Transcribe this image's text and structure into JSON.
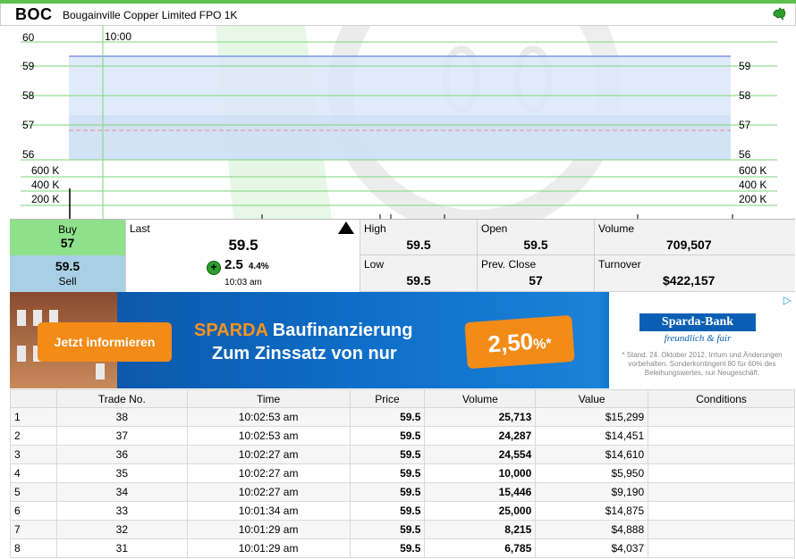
{
  "header": {
    "code": "BOC",
    "name": "Bougainville Copper Limited FPO 1K",
    "flag_icon": "australia-map-icon"
  },
  "chart": {
    "time_label": "10:00",
    "price_ticks": [
      "60",
      "59",
      "58",
      "57",
      "56"
    ],
    "volume_ticks": [
      "600 K",
      "400 K",
      "200 K"
    ],
    "colors": {
      "grid": "#7cd67a",
      "band": "#dbe8f8",
      "line": "#7a9be0"
    }
  },
  "quote": {
    "buy_label": "Buy",
    "buy_value": "57",
    "sell_label": "Sell",
    "sell_value": "59.5",
    "last_label": "Last",
    "last_value": "59.5",
    "change_value": "2.5",
    "change_pct": "4.4%",
    "last_time": "10:03 am",
    "high_label": "High",
    "high_value": "59.5",
    "low_label": "Low",
    "low_value": "59.5",
    "open_label": "Open",
    "open_value": "59.5",
    "prev_close_label": "Prev. Close",
    "prev_close_value": "57",
    "volume_label": "Volume",
    "volume_value": "709,507",
    "turnover_label": "Turnover",
    "turnover_value": "$422,157"
  },
  "ad": {
    "cta": "Jetzt informieren",
    "brand": "SPARDA",
    "headline1": "Baufinanzierung",
    "headline2": "Zum Zinssatz von nur",
    "rate": "2,50",
    "rate_suffix": "%*",
    "bank": "Sparda-Bank",
    "slogan": "freundlich & fair",
    "fineprint": "* Stand: 24. Oktober 2012, Irrtum und Änderungen vorbehalten. Sonderkontingent 80 für 60% des Beleihungswertes, nur Neugeschäft."
  },
  "trades": {
    "headers": [
      "",
      "Trade No.",
      "Time",
      "Price",
      "Volume",
      "Value",
      "Conditions"
    ],
    "rows": [
      [
        "1",
        "38",
        "10:02:53 am",
        "59.5",
        "25,713",
        "$15,299",
        ""
      ],
      [
        "2",
        "37",
        "10:02:53 am",
        "59.5",
        "24,287",
        "$14,451",
        ""
      ],
      [
        "3",
        "36",
        "10:02:27 am",
        "59.5",
        "24,554",
        "$14,610",
        ""
      ],
      [
        "4",
        "35",
        "10:02:27 am",
        "59.5",
        "10,000",
        "$5,950",
        ""
      ],
      [
        "5",
        "34",
        "10:02:27 am",
        "59.5",
        "15,446",
        "$9,190",
        ""
      ],
      [
        "6",
        "33",
        "10:01:34 am",
        "59.5",
        "25,000",
        "$14,875",
        ""
      ],
      [
        "7",
        "32",
        "10:01:29 am",
        "59.5",
        "8,215",
        "$4,888",
        ""
      ],
      [
        "8",
        "31",
        "10:01:29 am",
        "59.5",
        "6,785",
        "$4,037",
        ""
      ]
    ]
  }
}
